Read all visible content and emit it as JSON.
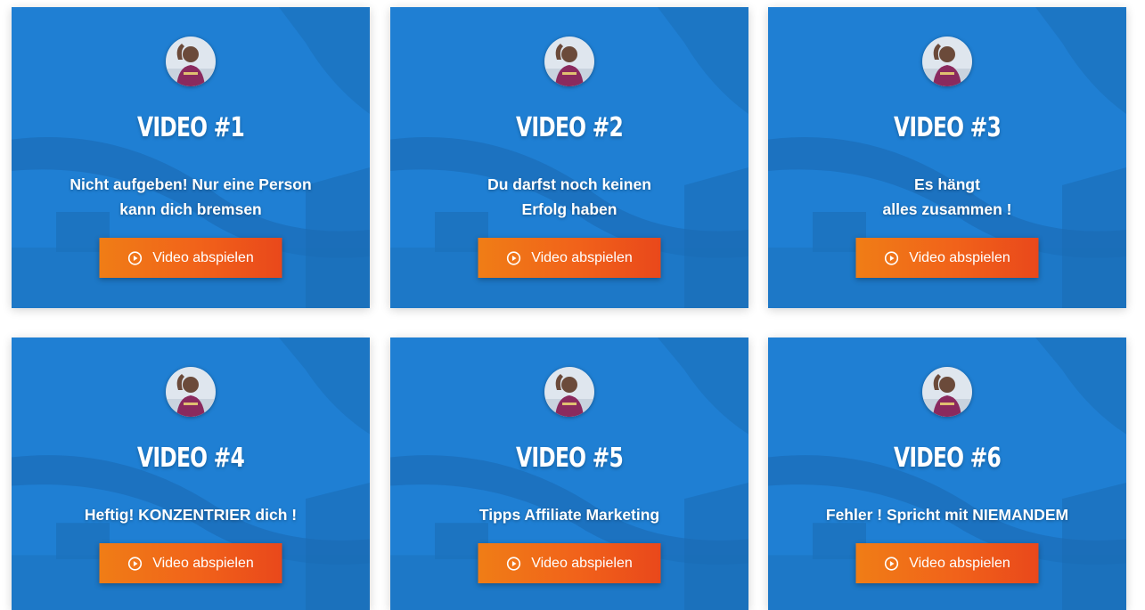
{
  "theme": {
    "card_blue": "#1f7fd3",
    "button_orange_start": "#f07d16",
    "button_orange_end": "#e9481b",
    "text_color": "#ffffff"
  },
  "cards": [
    {
      "title": "VIDEO #1",
      "description_lines": [
        "Nicht aufgeben! Nur eine Person",
        "kann dich bremsen"
      ],
      "button_label": "Video abspielen",
      "button_icon": "play-circle-icon",
      "avatar": "presenter-avatar"
    },
    {
      "title": "VIDEO #2",
      "description_lines": [
        "Du darfst noch keinen",
        "Erfolg haben"
      ],
      "button_label": "Video abspielen",
      "button_icon": "play-circle-icon",
      "avatar": "presenter-avatar"
    },
    {
      "title": "VIDEO #3",
      "description_lines": [
        "Es hängt",
        "alles zusammen !"
      ],
      "button_label": "Video abspielen",
      "button_icon": "play-circle-icon",
      "avatar": "presenter-avatar"
    },
    {
      "title": "VIDEO #4",
      "description_lines": [
        "Heftig! KONZENTRIER dich !"
      ],
      "button_label": "Video abspielen",
      "button_icon": "play-circle-icon",
      "avatar": "presenter-avatar"
    },
    {
      "title": "VIDEO #5",
      "description_lines": [
        "Tipps Affiliate Marketing"
      ],
      "button_label": "Video abspielen",
      "button_icon": "play-circle-icon",
      "avatar": "presenter-avatar"
    },
    {
      "title": "VIDEO #6",
      "description_lines": [
        "Fehler ! Spricht mit NIEMANDEM"
      ],
      "button_label": "Video abspielen",
      "button_icon": "play-circle-icon",
      "avatar": "presenter-avatar"
    }
  ]
}
